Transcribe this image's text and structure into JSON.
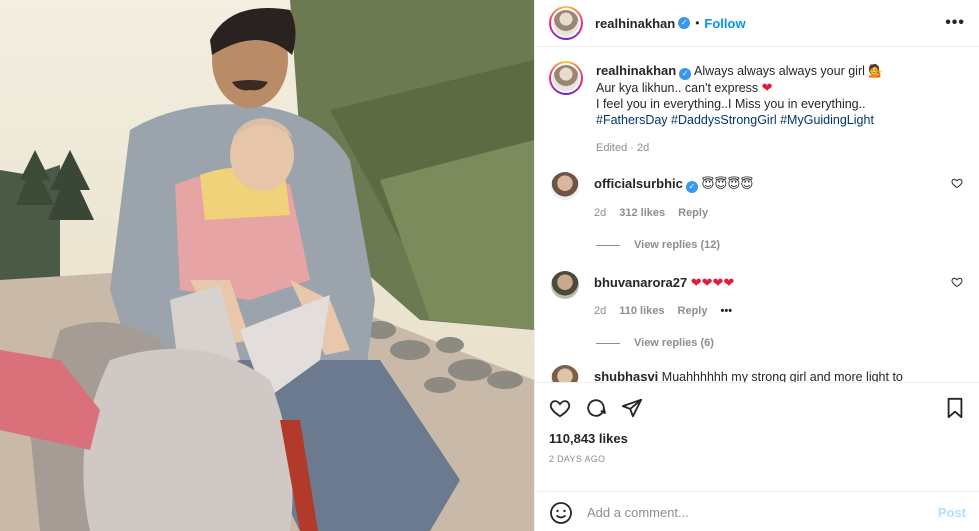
{
  "post": {
    "username": "realhinakhan",
    "follow_label": "Follow",
    "dot": "•",
    "more": "•••"
  },
  "caption": {
    "username": "realhinakhan",
    "line1": "Always always always your girl 💁",
    "line2": "Aur kya likhun.. can't express",
    "line3": "I feel you in everything..I Miss you in everything..",
    "hashtags": "#FathersDay #DaddysStrongGirl #MyGuidingLight",
    "meta": "Edited · 2d"
  },
  "comments": [
    {
      "username": "officialsurbhic",
      "text": "😇😇😇😇",
      "age": "2d",
      "likes": "312 likes",
      "reply": "Reply",
      "view_replies": "View replies (12)"
    },
    {
      "username": "bhuvanarora27",
      "text": "❤❤❤❤",
      "age": "2d",
      "likes": "110 likes",
      "reply": "Reply",
      "more": "•••",
      "view_replies": "View replies (6)"
    },
    {
      "username": "shubhasvi",
      "text": "Muahhhhhh my strong girl and more light to"
    }
  ],
  "footer": {
    "likes": "110,843 likes",
    "date": "2 DAYS AGO",
    "comment_placeholder": "Add a comment...",
    "post_label": "Post"
  },
  "colors": {
    "accent": "#0095f6",
    "heart": "#e21b3c",
    "muted": "#8e8e8e",
    "hashtag": "#00376b"
  }
}
